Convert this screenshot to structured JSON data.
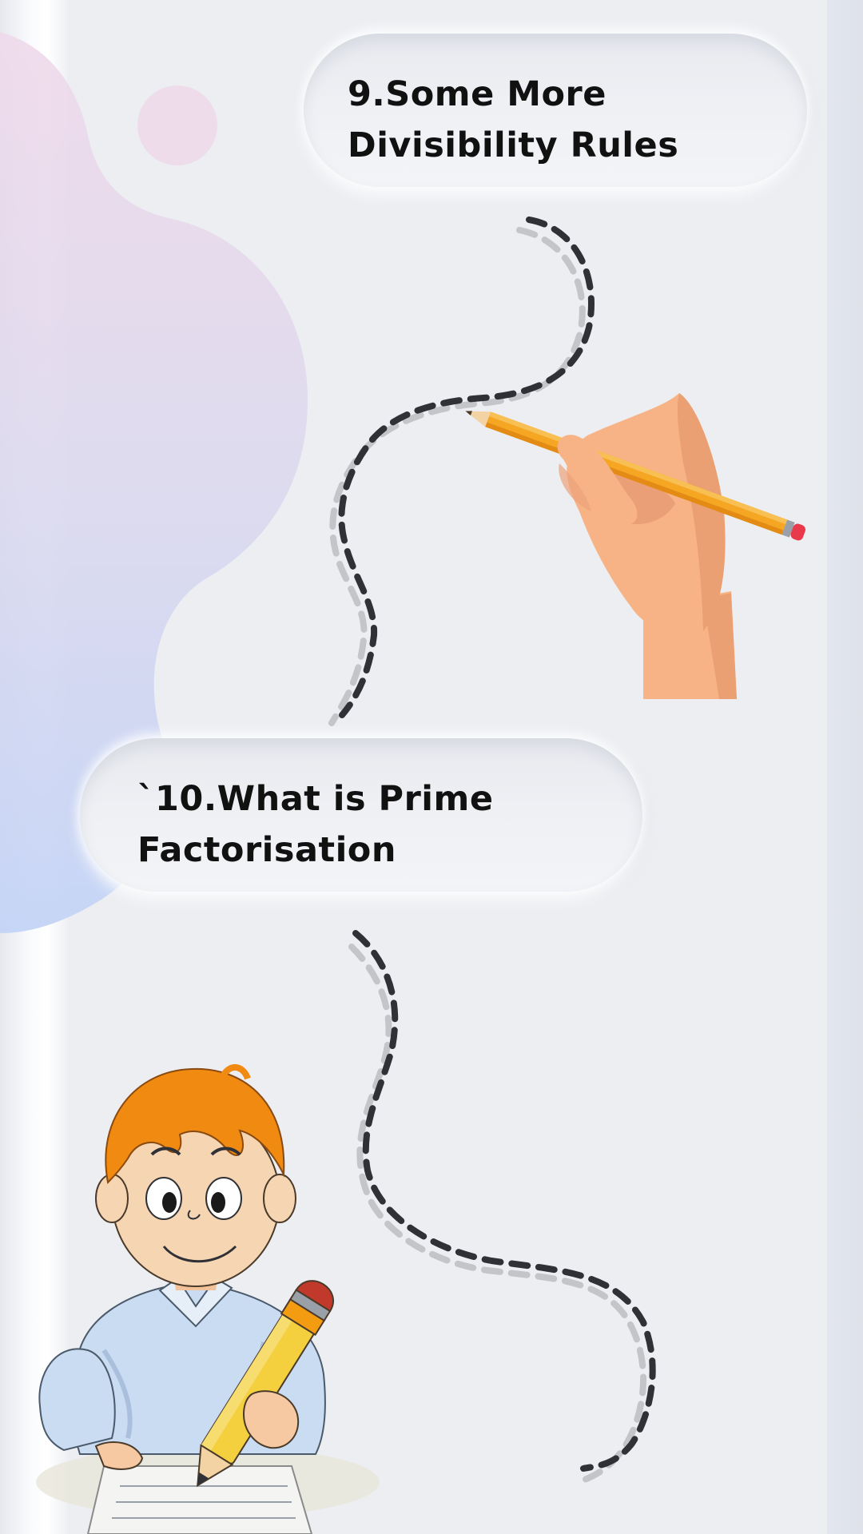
{
  "steps": [
    {
      "label": "9.Some More Divisibility Rules"
    },
    {
      "label": "`10.What is Prime Factorisation"
    }
  ],
  "colors": {
    "background": "#eceef2",
    "text": "#111111",
    "pencil_body": "#f5a623",
    "skin": "#f7b386",
    "shirt": "#c9dcf2",
    "hair": "#f08a10",
    "dash_dark": "#2f3136",
    "dash_light": "#c3c5c9"
  },
  "icons": [
    "hand-writing-pencil-illustration",
    "boy-with-pencil-illustration",
    "dashed-path"
  ]
}
